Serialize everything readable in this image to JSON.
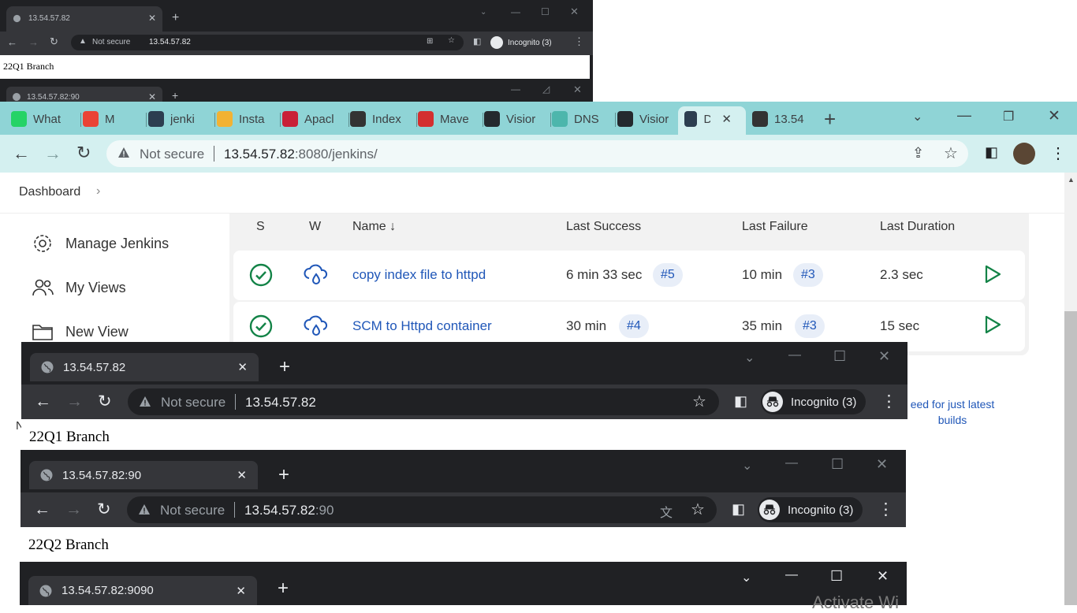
{
  "background_window": {
    "tab_title": "13.54.57.82",
    "not_secure": "Not secure",
    "url": "13.54.57.82",
    "incognito": "Incognito (3)",
    "page_text": "22Q1 Branch",
    "tab2_title": "13.54.57.82:90"
  },
  "main_window": {
    "tabs": [
      {
        "label": "What",
        "icon": "whatsapp-icon",
        "color": "#25D366"
      },
      {
        "label": "M",
        "icon": "gmail-icon",
        "color": "#EA4335"
      },
      {
        "label": "jenki",
        "icon": "jenkins-icon",
        "color": "#2c3e50"
      },
      {
        "label": "Insta",
        "icon": "box-icon",
        "color": "#f2b233"
      },
      {
        "label": "Apacl",
        "icon": "apache-icon",
        "color": "#c92037"
      },
      {
        "label": "Index",
        "icon": "globe-icon",
        "color": "#333333"
      },
      {
        "label": "Mave",
        "icon": "maven-icon",
        "color": "#d32f2f"
      },
      {
        "label": "Visior",
        "icon": "github-icon",
        "color": "#24292e"
      },
      {
        "label": "DNS",
        "icon": "dns-icon",
        "color": "#4db6ac"
      },
      {
        "label": "Visior",
        "icon": "github-icon",
        "color": "#24292e"
      },
      {
        "label": "D",
        "icon": "jenkins-icon",
        "color": "#2c3e50"
      },
      {
        "label": "13.54",
        "icon": "globe-icon",
        "color": "#333333"
      }
    ],
    "not_secure": "Not secure",
    "url_host": "13.54.57.82",
    "url_rest": ":8080/jenkins/"
  },
  "jenkins": {
    "breadcrumb": "Dashboard",
    "sidebar": [
      "Manage Jenkins",
      "My Views",
      "New View"
    ],
    "columns": [
      "S",
      "W",
      "Name ↓",
      "Last Success",
      "Last Failure",
      "Last Duration"
    ],
    "jobs": [
      {
        "name": "copy index file to httpd",
        "last_success": "6 min 33 sec",
        "success_build": "#5",
        "last_failure": "10 min",
        "failure_build": "#3",
        "duration": "2.3 sec"
      },
      {
        "name": "SCM to Httpd container",
        "last_success": "30 min",
        "success_build": "#4",
        "last_failure": "35 min",
        "failure_build": "#3",
        "duration": "15 sec"
      }
    ],
    "rss_link": "eed for just latest builds",
    "side_char": "N"
  },
  "popup1": {
    "tab_title": "13.54.57.82",
    "not_secure": "Not secure",
    "url_host": "13.54.57.82",
    "url_rest": "",
    "incognito": "Incognito (3)",
    "page_text": "22Q1 Branch"
  },
  "popup2": {
    "tab_title": "13.54.57.82:90",
    "not_secure": "Not secure",
    "url_host": "13.54.57.82",
    "url_rest": ":90",
    "incognito": "Incognito (3)",
    "page_text": "22Q2 Branch"
  },
  "popup3": {
    "tab_title": "13.54.57.82:9090"
  },
  "watermark": "Activate Wi"
}
